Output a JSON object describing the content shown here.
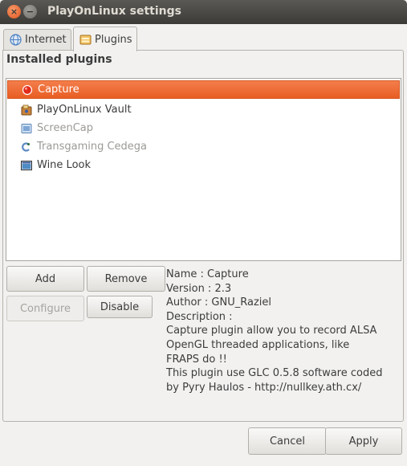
{
  "window": {
    "title": "PlayOnLinux settings",
    "close_glyph": "×",
    "minimize_glyph": "−"
  },
  "tabs": [
    {
      "label": "Internet",
      "icon": "globe-icon"
    },
    {
      "label": "Plugins",
      "icon": "plugin-folder-icon"
    }
  ],
  "active_tab": "Plugins",
  "section_title": "Installed plugins",
  "plugins": [
    {
      "label": "Capture",
      "icon": "record-icon",
      "state": "selected"
    },
    {
      "label": "PlayOnLinux Vault",
      "icon": "vault-icon",
      "state": "enabled"
    },
    {
      "label": "ScreenCap",
      "icon": "screencap-icon",
      "state": "disabled"
    },
    {
      "label": "Transgaming Cedega",
      "icon": "cedega-icon",
      "state": "disabled"
    },
    {
      "label": "Wine Look",
      "icon": "winelook-icon",
      "state": "enabled"
    }
  ],
  "buttons": {
    "add": "Add",
    "remove": "Remove",
    "configure": "Configure",
    "disable": "Disable",
    "cancel": "Cancel",
    "apply": "Apply"
  },
  "description": {
    "lines": [
      "Name : Capture",
      "Version : 2.3",
      "Author : GNU_Raziel",
      "Description :",
      "Capture plugin allow you to record ALSA",
      "OpenGL threaded applications, like",
      "FRAPS do !!",
      "This plugin use GLC 0.5.8 software coded",
      "by Pyry Haulos - http://nullkey.ath.cx/"
    ]
  },
  "colors": {
    "titlebar": "#3c3b37",
    "selection": "#e85d24",
    "close_button": "#e0541f"
  }
}
